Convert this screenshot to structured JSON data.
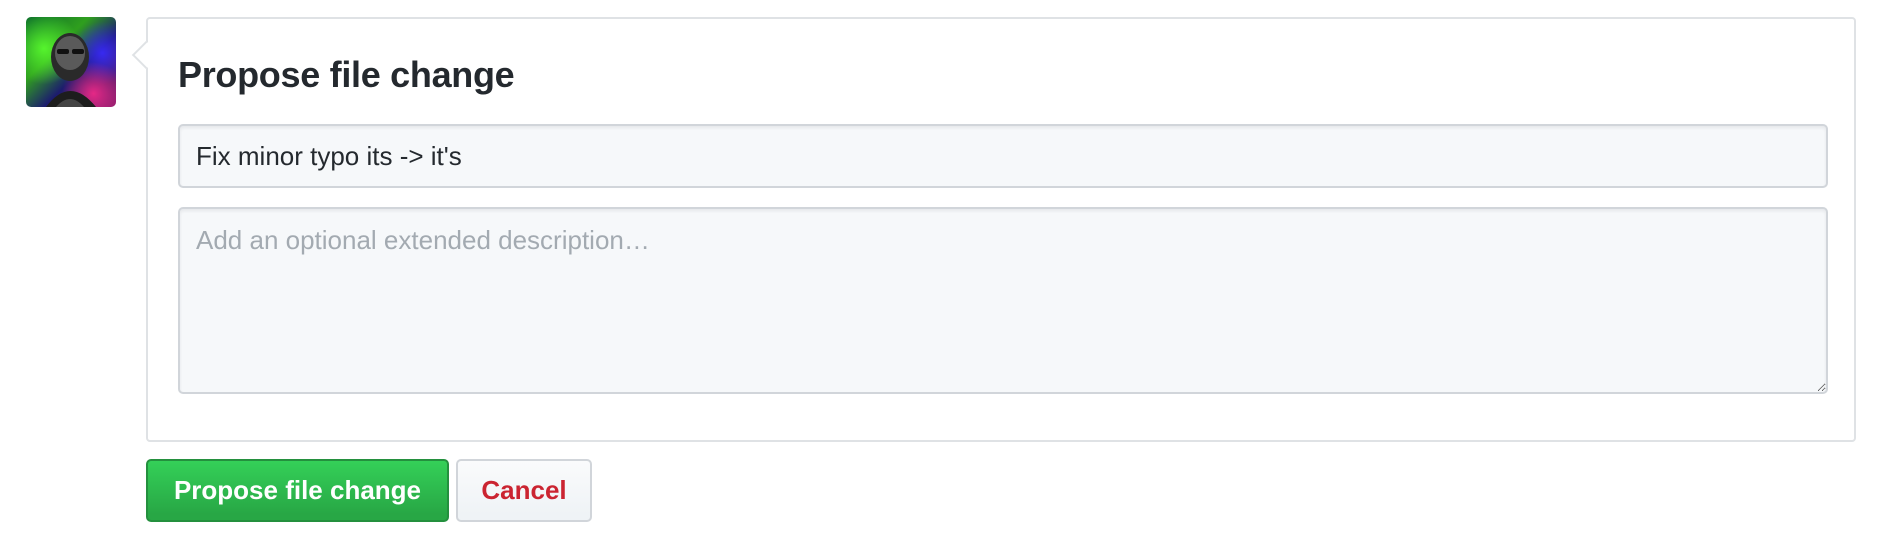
{
  "user": {
    "avatar_icon": "user-avatar"
  },
  "commit": {
    "title": "Propose file change",
    "summary_value": "Fix minor typo its -> it's",
    "description_placeholder": "Add an optional extended description…"
  },
  "actions": {
    "submit_label": "Propose file change",
    "cancel_label": "Cancel"
  },
  "colors": {
    "primary": "#28a745",
    "danger": "#cb2431",
    "border": "#dfe2e5"
  }
}
